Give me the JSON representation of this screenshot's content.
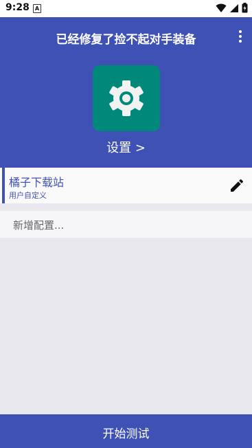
{
  "status_bar": {
    "time": "9:28",
    "notification_letter": "A"
  },
  "header": {
    "title": "已经修复了捡不起对手装备",
    "settings_label": "设置 >"
  },
  "config": {
    "name": "橘子下载站",
    "type": "用户自定义"
  },
  "add_config": {
    "label": "新增配置..."
  },
  "bottom": {
    "start_label": "开始测试"
  },
  "colors": {
    "primary": "#3F51B5",
    "tile": "#00897B",
    "background": "#E8E8EE"
  },
  "icons": [
    "wifi-icon",
    "signal-icon",
    "battery-icon",
    "more-vert-icon",
    "gear-icon",
    "edit-pencil-icon"
  ]
}
